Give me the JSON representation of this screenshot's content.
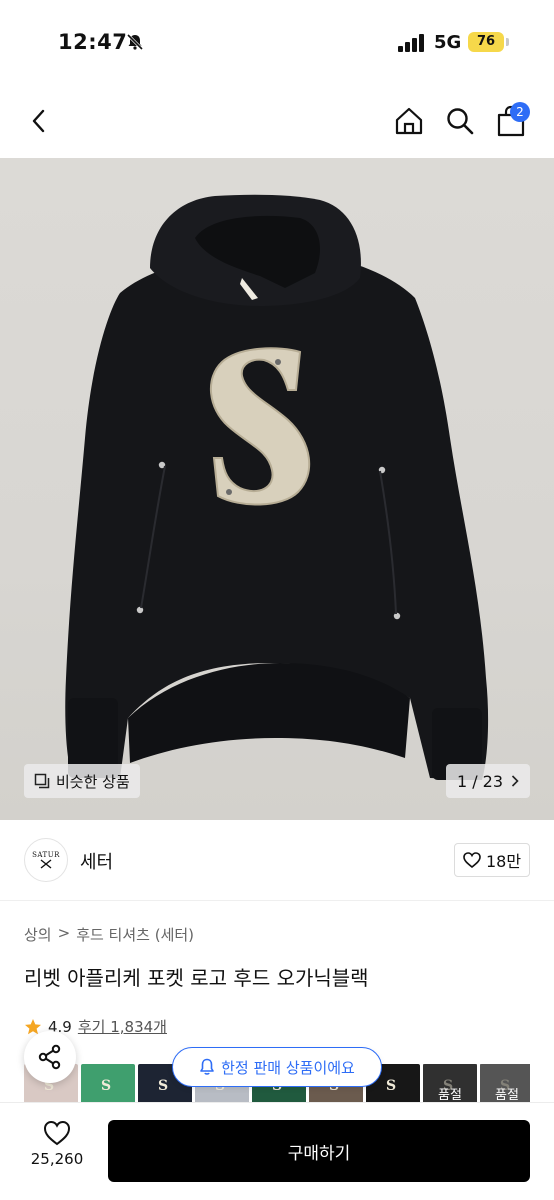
{
  "status_bar": {
    "time": "12:47",
    "network": "5G",
    "battery": "76"
  },
  "nav": {
    "cart_count": "2"
  },
  "hero": {
    "similar_label": "비슷한 상품",
    "counter": "1 / 23"
  },
  "brand": {
    "logo_text": "SATUR",
    "name": "세터"
  },
  "like": {
    "count": "18만"
  },
  "breadcrumb": {
    "level1": "상의",
    "sep": ">",
    "level2": "후드 티셔츠 (세터)"
  },
  "product": {
    "title": "리벳 아플리케 포켓 로고 후드 오가닉블랙",
    "rating": "4.9",
    "review_label": "후기 1,834개"
  },
  "toast": {
    "text": "한정 판매 상품이에요"
  },
  "thumbs": [
    {
      "color": "#d9c9c4",
      "sold_out": ""
    },
    {
      "color": "#3f9f6e",
      "sold_out": ""
    },
    {
      "color": "#1d2433",
      "sold_out": ""
    },
    {
      "color": "#b8bcc4",
      "sold_out": ""
    },
    {
      "color": "#205a3e",
      "sold_out": ""
    },
    {
      "color": "#6b5b4e",
      "sold_out": ""
    },
    {
      "color": "#171717",
      "sold_out": ""
    },
    {
      "color": "#3a3a3a",
      "sold_out": "품절"
    },
    {
      "color": "#8c8c8c",
      "sold_out": "품절"
    }
  ],
  "bottom": {
    "wish_count": "25,260",
    "buy_label": "구매하기"
  },
  "colors": {
    "accent": "#2e6df6",
    "star": "#f5a623",
    "primary_button": "#000000"
  }
}
